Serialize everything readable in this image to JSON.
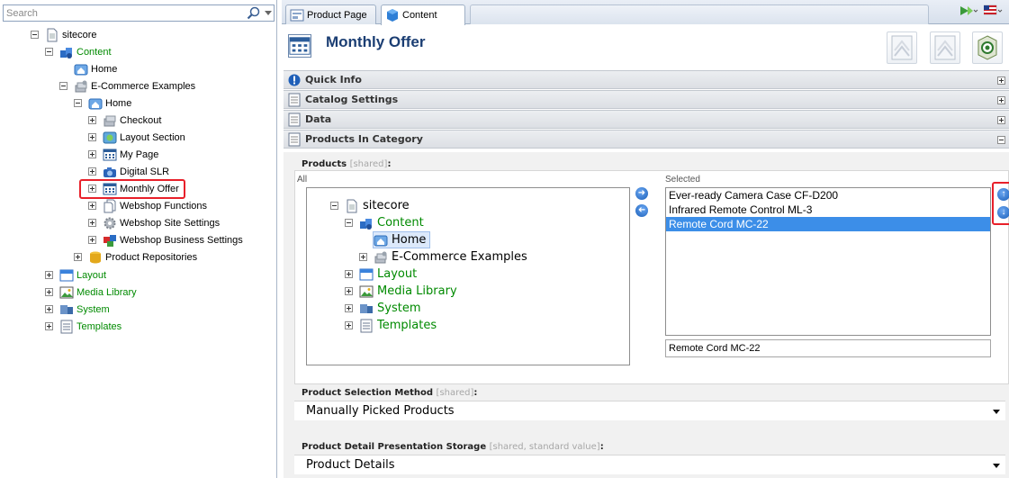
{
  "search": {
    "placeholder": "Search"
  },
  "tree": {
    "sitecore": "sitecore",
    "content": "Content",
    "home1": "Home",
    "ecommerce": "E-Commerce Examples",
    "home2": "Home",
    "checkout": "Checkout",
    "layout_section": "Layout Section",
    "my_page": "My Page",
    "digital_slr": "Digital SLR",
    "monthly_offer": "Monthly Offer",
    "webshop_functions": "Webshop Functions",
    "webshop_site_settings": "Webshop Site Settings",
    "webshop_business_settings": "Webshop Business Settings",
    "product_repositories": "Product Repositories",
    "layout": "Layout",
    "media_library": "Media Library",
    "system": "System",
    "templates": "Templates"
  },
  "tabs": {
    "product_page": "Product Page",
    "content": "Content"
  },
  "header": {
    "title": "Monthly Offer"
  },
  "sections": {
    "quick_info": "Quick Info",
    "catalog_settings": "Catalog Settings",
    "data": "Data",
    "products_in_category": "Products In Category"
  },
  "products_field": {
    "label": "Products",
    "shared": "[shared]",
    "colon": ":",
    "all_label": "All",
    "selected_label": "Selected",
    "tree": {
      "sitecore": "sitecore",
      "content": "Content",
      "home": "Home",
      "ecommerce": "E-Commerce Examples",
      "layout": "Layout",
      "media_library": "Media Library",
      "system": "System",
      "templates": "Templates"
    },
    "selected_items": [
      "Ever-ready Camera Case CF-D200",
      "Infrared Remote Control ML-3",
      "Remote Cord MC-22"
    ],
    "selected_value": "Remote Cord MC-22"
  },
  "selection_method": {
    "label": "Product Selection Method",
    "shared": "[shared]",
    "colon": ":",
    "value": "Manually Picked Products"
  },
  "presentation_storage": {
    "label": "Product Detail Presentation Storage",
    "shared": "[shared, standard value]",
    "colon": ":",
    "value": "Product Details"
  },
  "colors": {
    "accent": "#1b3e73",
    "highlight": "#e8202a",
    "selection": "#3c8ee8",
    "tree_green": "#008a00"
  }
}
